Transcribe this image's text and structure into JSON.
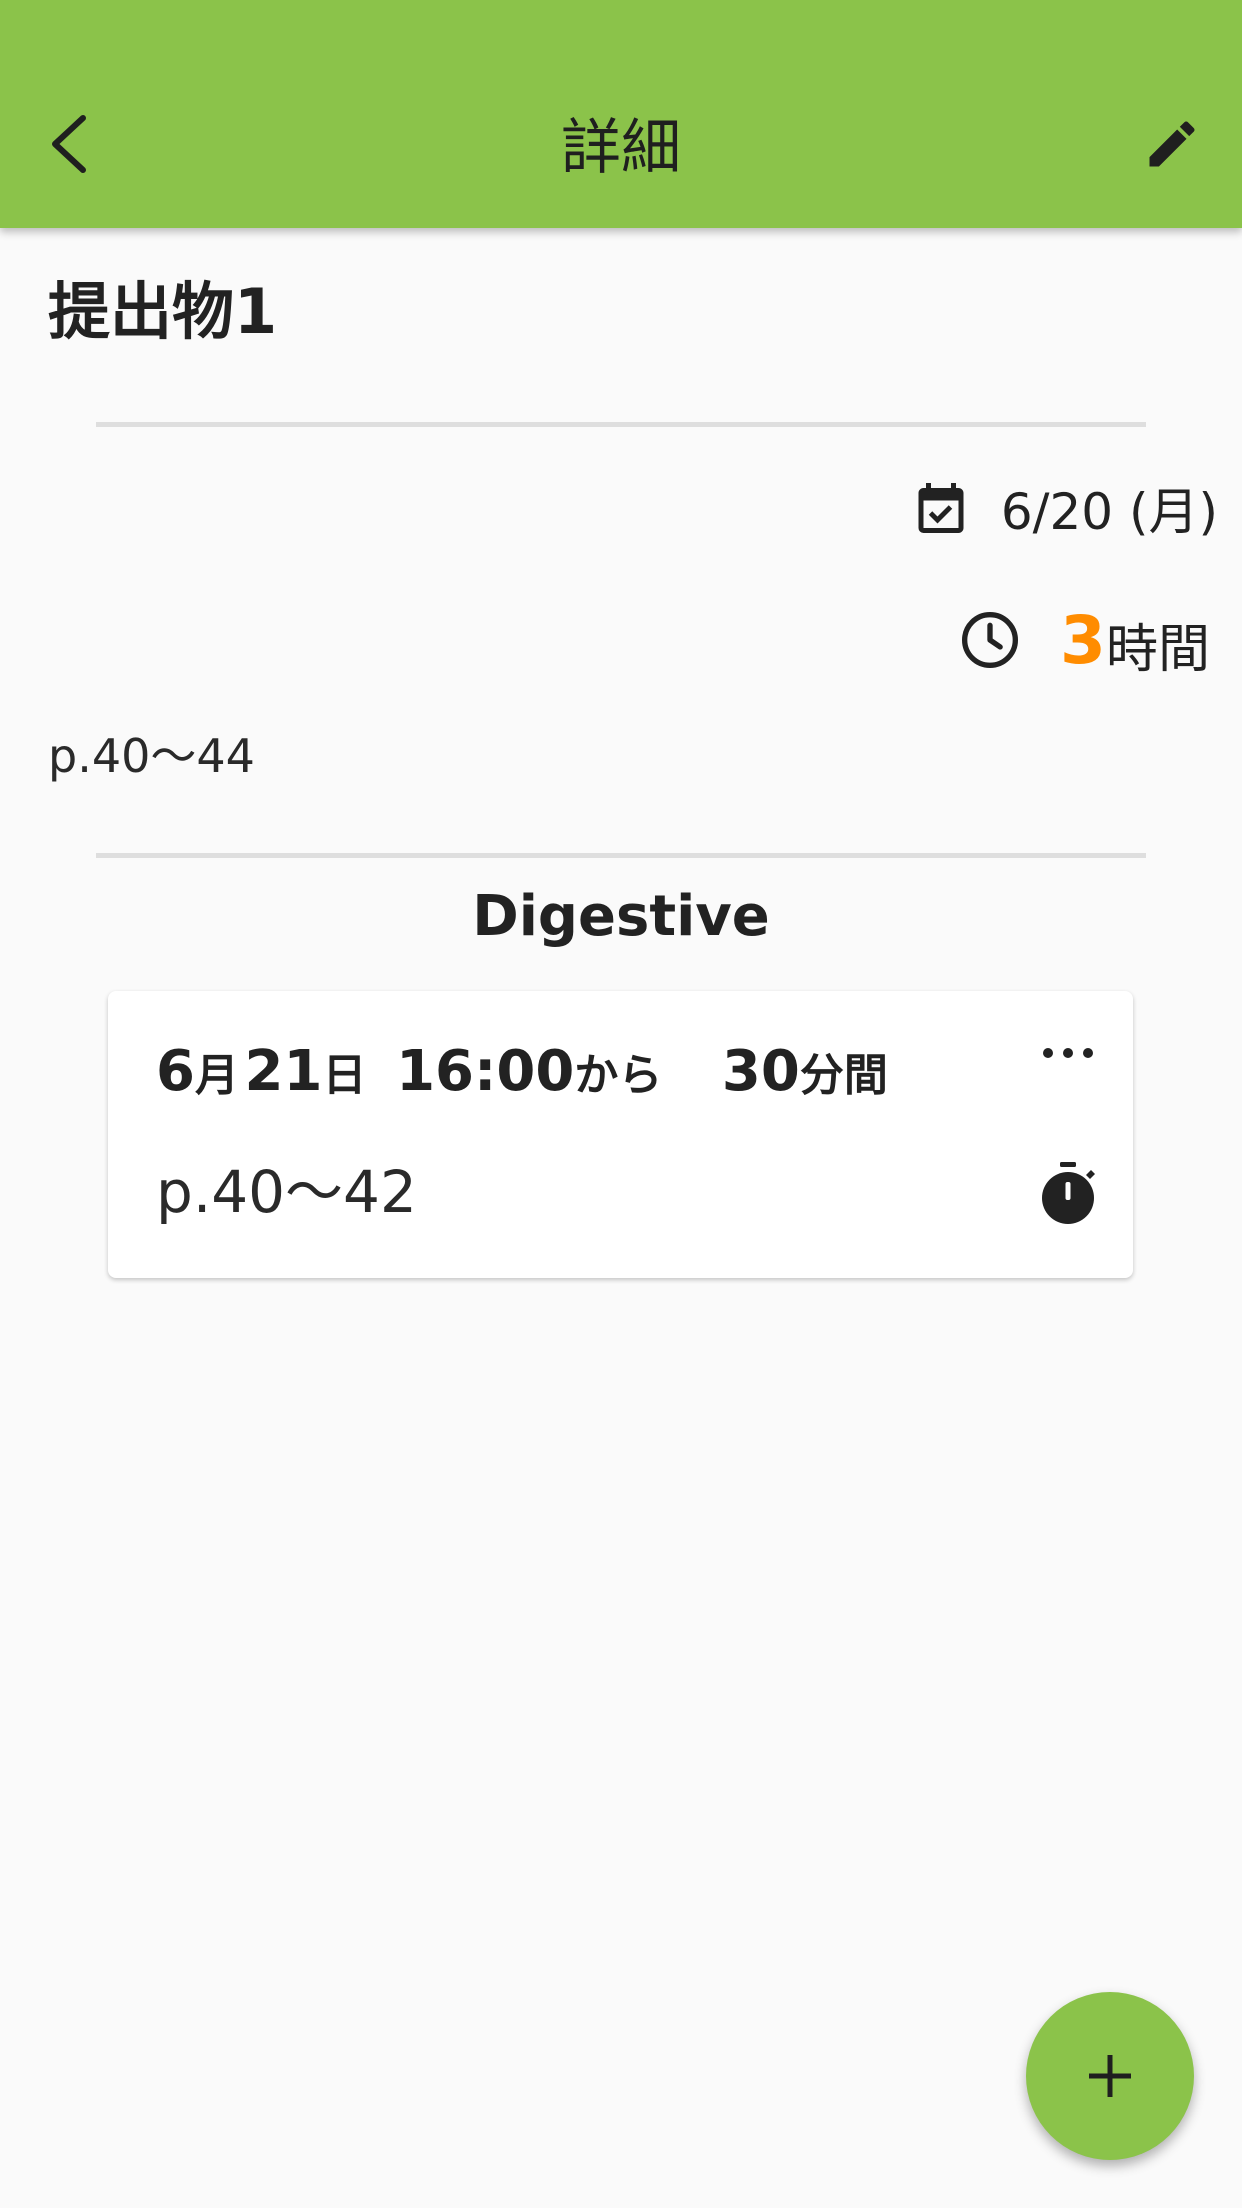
{
  "app_bar": {
    "title": "詳細",
    "back_icon": "chevron-left-icon",
    "edit_icon": "pencil-icon",
    "color": "#8bc34a"
  },
  "assignment": {
    "title": "提出物1",
    "due_date": "6/20 (月)",
    "due_icon": "calendar-check-icon",
    "estimated_hours": "3",
    "estimated_hours_unit": "時間",
    "hours_color": "#ff8c00",
    "clock_icon": "clock-icon",
    "memo": "p.40～44"
  },
  "subject": {
    "name": "Digestive"
  },
  "sessions": [
    {
      "month": "6",
      "month_unit": "月",
      "day": "21",
      "day_unit": "日",
      "start_time": "16:00",
      "start_suffix": "から",
      "duration": "30",
      "duration_unit": "分間",
      "memo": "p.40～42",
      "menu_icon": "more-horizontal-icon",
      "timer_icon": "stopwatch-icon"
    }
  ],
  "fab": {
    "icon": "plus-icon",
    "color": "#8bc34a"
  }
}
